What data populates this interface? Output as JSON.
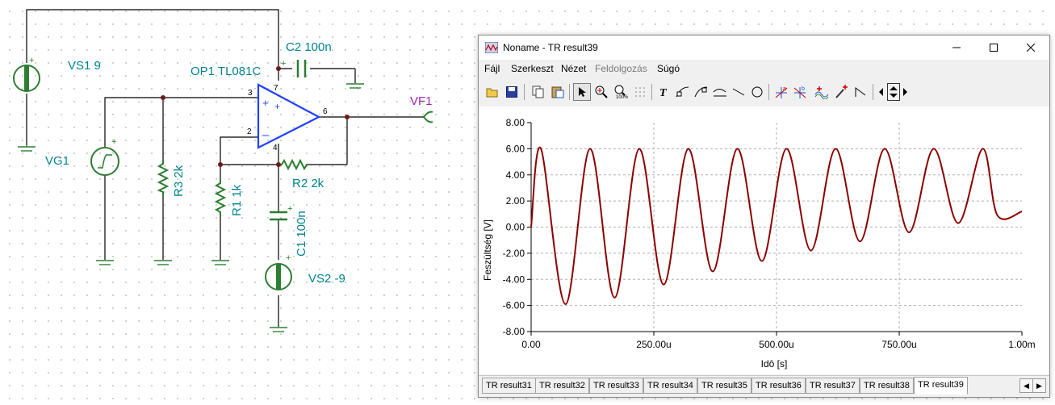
{
  "schematic": {
    "vs1": "VS1 9",
    "vg1": "VG1",
    "op1": "OP1 TL081C",
    "c2": "C2 100n",
    "r3": "R3 2k",
    "r1": "R1 1k",
    "r2": "R2 2k",
    "c1": "C1 100n",
    "vs2": "VS2 -9",
    "vf1": "VF1",
    "pin3": "3",
    "pin2": "2",
    "pin6": "6",
    "pin7": "7",
    "pin4": "4"
  },
  "window": {
    "title": "Noname - TR result39",
    "menu": [
      "Fájl",
      "Szerkeszt",
      "Nézet",
      "Feldolgozás",
      "Súgó"
    ],
    "disabled_menu_index": 3,
    "tabs": [
      "TR result31",
      "TR result32",
      "TR result33",
      "TR result34",
      "TR result35",
      "TR result36",
      "TR result37",
      "TR result38",
      "TR result39"
    ],
    "active_tab": "TR result39",
    "toolbar_icons": [
      "open-icon",
      "save-icon",
      "copy-icon",
      "paste-icon",
      "pointer-icon",
      "zoom-icon",
      "zoom-100-icon",
      "grid-icon",
      "text-icon",
      "cursor-a-icon",
      "cursor-b-icon",
      "tangent-icon",
      "line-icon",
      "circle-icon",
      "marker-a-icon",
      "marker-b-icon",
      "wave-icon",
      "probe-icon",
      "ramp-icon",
      "scroll-left-icon",
      "scroll-updown-icon",
      "scroll-right-icon"
    ]
  },
  "chart_data": {
    "type": "line",
    "xlabel": "Idô [s]",
    "ylabel": "Feszültség [V]",
    "xlim": [
      0,
      0.001
    ],
    "ylim": [
      -8,
      8
    ],
    "x_ticks": [
      "0.00",
      "250.00u",
      "500.00u",
      "750.00u",
      "1.00m"
    ],
    "y_ticks": [
      "8.00",
      "6.00",
      "4.00",
      "2.00",
      "0.00",
      "-2.00",
      "-4.00",
      "-6.00",
      "-8.00"
    ],
    "grid": true,
    "line_color": "#8b0000",
    "series": [
      {
        "x": [
          0,
          2e-05,
          7e-05,
          0.00012,
          0.00017,
          0.00022,
          0.00027,
          0.00032,
          0.00037,
          0.00042,
          0.00047,
          0.00052,
          0.00057,
          0.00062,
          0.00067,
          0.00072,
          0.00077,
          0.00082,
          0.00087,
          0.00092,
          0.00095,
          0.001
        ],
        "y": [
          0,
          6.0,
          -5.9,
          6.0,
          -5.4,
          6.0,
          -4.4,
          6.0,
          -3.4,
          6.0,
          -2.6,
          6.0,
          -1.8,
          6.0,
          -1.1,
          6.0,
          -0.4,
          6.0,
          0.3,
          6.0,
          0.9,
          1.2
        ]
      }
    ]
  }
}
